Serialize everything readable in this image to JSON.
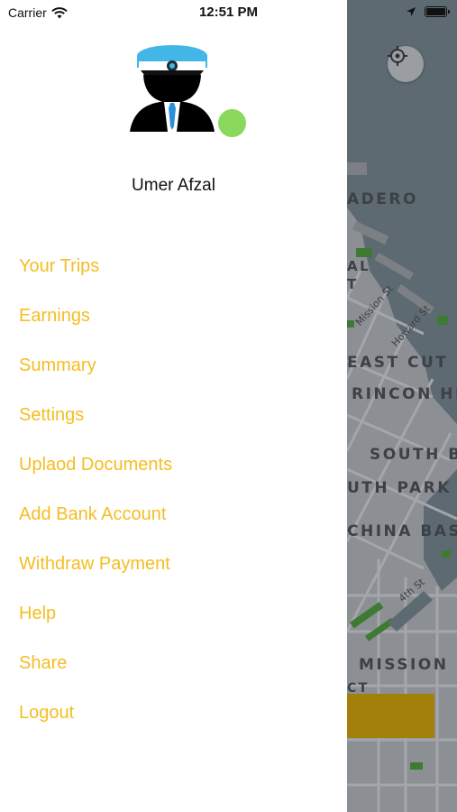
{
  "status_bar": {
    "carrier": "Carrier",
    "time": "12:51 PM"
  },
  "drawer": {
    "user_name": "Umer Afzal",
    "online_color": "#8ad85c",
    "menu_color": "#f5bd22",
    "menu": [
      {
        "label": "Your Trips"
      },
      {
        "label": "Earnings"
      },
      {
        "label": "Summary"
      },
      {
        "label": "Settings"
      },
      {
        "label": "Uplaod Documents"
      },
      {
        "label": "Add Bank Account"
      },
      {
        "label": "Withdraw Payment"
      },
      {
        "label": "Help"
      },
      {
        "label": "Share"
      },
      {
        "label": "Logout"
      }
    ]
  },
  "map": {
    "labels": [
      "ADERO",
      "AL",
      "T",
      "EAST CUT",
      "RINCON HI",
      "SOUTH B",
      "UTH PARK",
      "CHINA BASI",
      "MISSION B",
      "CT"
    ],
    "streets": [
      "Mission St",
      "Howard St",
      "4th St"
    ]
  }
}
